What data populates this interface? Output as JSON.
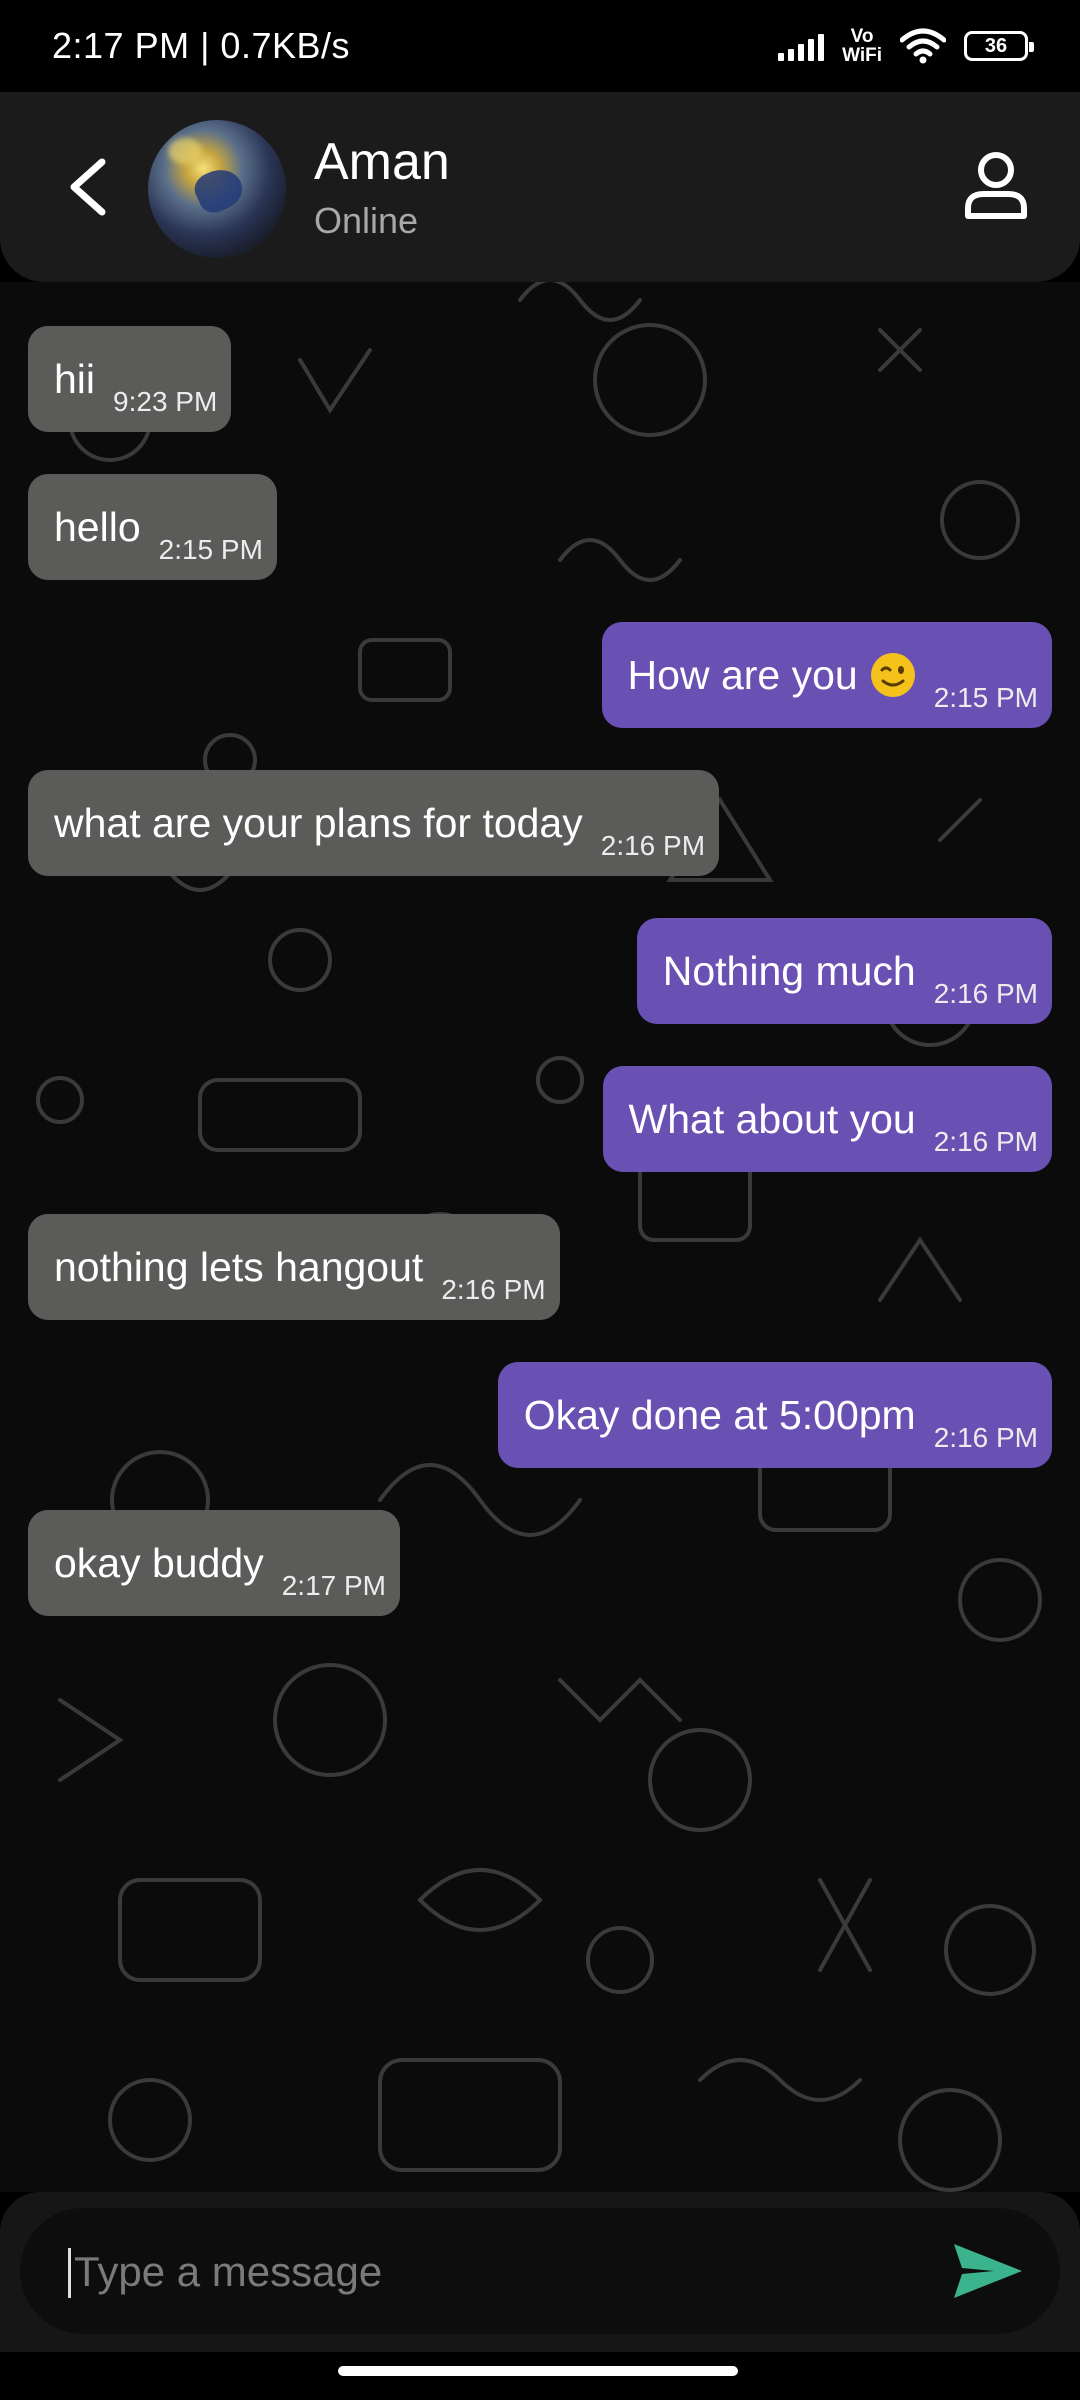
{
  "status_bar": {
    "time_speed": "2:17 PM | 0.7KB/s",
    "vowifi_top": "Vo",
    "vowifi_bottom": "WiFi",
    "battery": "36"
  },
  "header": {
    "contact_name": "Aman",
    "contact_status": "Online"
  },
  "messages": [
    {
      "direction": "in",
      "text": "hii",
      "time": "9:23 PM"
    },
    {
      "direction": "in",
      "text": "hello",
      "time": "2:15 PM"
    },
    {
      "direction": "out",
      "text": "How are you",
      "emoji": "wink-emoji",
      "time": "2:15 PM"
    },
    {
      "direction": "in",
      "text": "what are your plans for today",
      "time": "2:16 PM"
    },
    {
      "direction": "out",
      "text": "Nothing much",
      "time": "2:16 PM"
    },
    {
      "direction": "out",
      "text": "What about you",
      "time": "2:16 PM"
    },
    {
      "direction": "in",
      "text": "nothing lets hangout",
      "time": "2:16 PM"
    },
    {
      "direction": "out",
      "text": "Okay done at 5:00pm",
      "time": "2:16 PM"
    },
    {
      "direction": "in",
      "text": "okay buddy",
      "time": "2:17 PM"
    }
  ],
  "composer": {
    "placeholder": "Type a message",
    "value": ""
  },
  "colors": {
    "incoming_bubble": "#5b5b59",
    "outgoing_bubble": "#6950b3",
    "send_accent": "#3bb48d",
    "header_bg": "#1b1b1b"
  },
  "icons": {
    "back": "back-arrow-icon",
    "profile": "person-icon",
    "send": "send-icon"
  }
}
